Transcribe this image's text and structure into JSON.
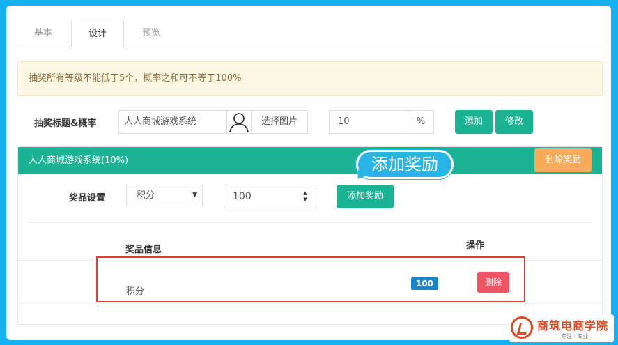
{
  "tabs": [
    {
      "label": "基本",
      "active": false
    },
    {
      "label": "设计",
      "active": true
    },
    {
      "label": "预览",
      "active": false
    }
  ],
  "alert": {
    "text": "抽奖所有等级不能低于5个，概率之和可不等于100%"
  },
  "form": {
    "label": "抽奖标题&概率",
    "title_value": "人人商城游戏系统",
    "pick_image_label": "选择图片",
    "rate_value": "10",
    "rate_unit": "%",
    "add_label": "添加",
    "edit_label": "修改"
  },
  "reward": {
    "header": "人人商城游戏系统(10%)",
    "delete_reward_label": "删除奖励",
    "prize_setting_label": "奖品设置",
    "prize_type_selected": "积分",
    "prize_amount": "100",
    "add_prize_label": "添加奖励",
    "table": {
      "col_info": "奖品信息",
      "col_ops": "操作",
      "rows": [
        {
          "name": "积分",
          "amount": "100",
          "delete_label": "删除"
        }
      ]
    }
  },
  "callout": {
    "text": "添加奖励"
  },
  "logo": {
    "text": "商筑电商学院",
    "sub": "专注 · 专业"
  },
  "colors": {
    "background": "#16b0f0",
    "primary": "#1bb394",
    "warning": "#f8ac59",
    "danger": "#ed5565",
    "badge": "#1c84c6",
    "highlight_box": "#e53a3a"
  }
}
